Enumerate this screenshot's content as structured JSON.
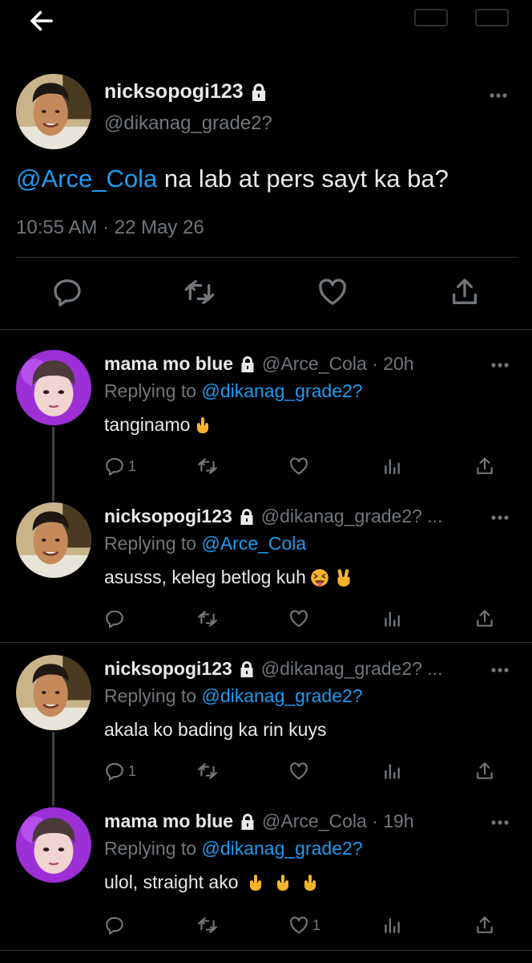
{
  "main": {
    "name": "nicksopogi123",
    "handle": "@dikanag_grade2?",
    "mention": "@Arce_Cola",
    "text": " na lab at pers sayt ka ba?",
    "timestamp": "10:55 AM · 22 May 26"
  },
  "replies": [
    {
      "name": "mama mo blue",
      "meta": "@Arce_Cola · 20h",
      "replying_prefix": "Replying to ",
      "replying_to": "@dikanag_grade2?",
      "text": "tanginamo",
      "reply_count": "1",
      "like_count": ""
    },
    {
      "name": "nicksopogi123",
      "meta": "@dikanag_grade2? ...",
      "replying_prefix": "Replying to ",
      "replying_to": "@Arce_Cola",
      "text": "asusss, keleg betlog kuh",
      "reply_count": "",
      "like_count": ""
    },
    {
      "name": "nicksopogi123",
      "meta": "@dikanag_grade2? ...",
      "replying_prefix": "Replying to ",
      "replying_to": "@dikanag_grade2?",
      "text": "akala ko bading ka rin kuys",
      "reply_count": "1",
      "like_count": ""
    },
    {
      "name": "mama mo blue",
      "meta": "@Arce_Cola · 19h",
      "replying_prefix": "Replying to ",
      "replying_to": "@dikanag_grade2?",
      "text": "ulol, straight ako",
      "reply_count": "",
      "like_count": "1"
    }
  ],
  "colors": {
    "background": "#000000",
    "text": "#e7e9ea",
    "muted": "#71767b",
    "link": "#1d9bf0",
    "divider": "#2f3336"
  },
  "icons": [
    "back-arrow-icon",
    "lock-icon",
    "more-icon",
    "reply-icon",
    "retweet-icon",
    "like-icon",
    "views-icon",
    "share-icon",
    "middle-finger-emoji",
    "squint-tongue-emoji",
    "victory-hand-emoji"
  ]
}
